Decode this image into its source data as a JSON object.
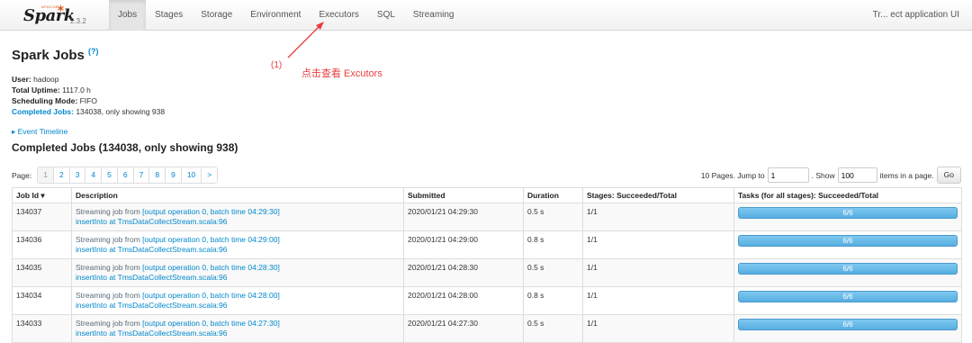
{
  "nav": {
    "logo_text": "Spark",
    "logo_apache": "APACHE",
    "version": "2.3.2",
    "tabs": [
      "Jobs",
      "Stages",
      "Storage",
      "Environment",
      "Executors",
      "SQL",
      "Streaming"
    ],
    "active_tab": "Jobs",
    "app_title": "Tr... ect application UI"
  },
  "page": {
    "title": "Spark Jobs",
    "help": "(?)",
    "user_label": "User:",
    "user": "hadoop",
    "uptime_label": "Total Uptime:",
    "uptime": "1117.0 h",
    "scheduling_label": "Scheduling Mode:",
    "scheduling": "FIFO",
    "completed_label": "Completed Jobs:",
    "completed": "134038, only showing 938",
    "timeline": "▸ Event Timeline",
    "section_title": "Completed Jobs (134038, only showing 938)"
  },
  "annotation": {
    "number": "(1)",
    "text": "点击查看 Excutors",
    "color": "#e83e3e"
  },
  "pager": {
    "label": "Page:",
    "pages": [
      "1",
      "2",
      "3",
      "4",
      "5",
      "6",
      "7",
      "8",
      "9",
      "10",
      ">"
    ],
    "summary": "10 Pages. Jump to",
    "jump_value": "1",
    "show_label": ". Show",
    "show_value": "100",
    "items_label": "items in a page.",
    "go_label": "Go"
  },
  "table": {
    "headers": {
      "job_id": "Job Id ▾",
      "description": "Description",
      "submitted": "Submitted",
      "duration": "Duration",
      "stages": "Stages: Succeeded/Total",
      "tasks": "Tasks (for all stages): Succeeded/Total"
    },
    "rows": [
      {
        "id": "134037",
        "desc_prefix": "Streaming job from ",
        "desc_link": "[output operation 0, batch time 04:29:30]",
        "desc_line2": "insertInto at TmsDataCollectStream.scala:96",
        "submitted": "2020/01/21 04:29:30",
        "duration": "0.5 s",
        "stages": "1/1",
        "tasks": "6/6",
        "progress": 1.0
      },
      {
        "id": "134036",
        "desc_prefix": "Streaming job from ",
        "desc_link": "[output operation 0, batch time 04:29:00]",
        "desc_line2": "insertInto at TmsDataCollectStream.scala:96",
        "submitted": "2020/01/21 04:29:00",
        "duration": "0.8 s",
        "stages": "1/1",
        "tasks": "6/6",
        "progress": 1.0
      },
      {
        "id": "134035",
        "desc_prefix": "Streaming job from ",
        "desc_link": "[output operation 0, batch time 04:28:30]",
        "desc_line2": "insertInto at TmsDataCollectStream.scala:96",
        "submitted": "2020/01/21 04:28:30",
        "duration": "0.5 s",
        "stages": "1/1",
        "tasks": "6/6",
        "progress": 1.0
      },
      {
        "id": "134034",
        "desc_prefix": "Streaming job from ",
        "desc_link": "[output operation 0, batch time 04:28:00]",
        "desc_line2": "insertInto at TmsDataCollectStream.scala:96",
        "submitted": "2020/01/21 04:28:00",
        "duration": "0.8 s",
        "stages": "1/1",
        "tasks": "6/6",
        "progress": 1.0
      },
      {
        "id": "134033",
        "desc_prefix": "Streaming job from ",
        "desc_link": "[output operation 0, batch time 04:27:30]",
        "desc_line2": "insertInto at TmsDataCollectStream.scala:96",
        "submitted": "2020/01/21 04:27:30",
        "duration": "0.5 s",
        "stages": "1/1",
        "tasks": "6/6",
        "progress": 1.0
      }
    ]
  }
}
